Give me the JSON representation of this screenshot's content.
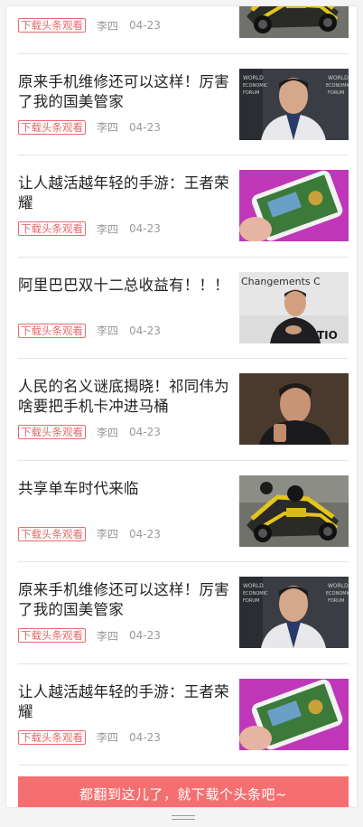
{
  "feed": {
    "items": [
      {
        "title": "",
        "tag": "下载头条观看",
        "author": "李四",
        "date": "04-23",
        "image": "robot-vehicle"
      },
      {
        "title": "原来手机维修还可以这样！厉害了我的国美管家",
        "tag": "下载头条观看",
        "author": "李四",
        "date": "04-23",
        "image": "forum-speaker"
      },
      {
        "title": "让人越活越年轻的手游：王者荣耀",
        "tag": "下载头条观看",
        "author": "李四",
        "date": "04-23",
        "image": "mobile-game"
      },
      {
        "title": "阿里巴巴双十二总收益有！！！",
        "tag": "下载头条观看",
        "author": "李四",
        "date": "04-23",
        "image": "stage-speaker",
        "image_text": "Changements C"
      },
      {
        "title": "人民的名义谜底揭晓！祁同伟为啥要把手机卡冲进马桶",
        "tag": "下载头条观看",
        "author": "李四",
        "date": "04-23",
        "image": "actor-portrait"
      },
      {
        "title": "共享单车时代来临",
        "tag": "下载头条观看",
        "author": "李四",
        "date": "04-23",
        "image": "robot-vehicle"
      },
      {
        "title": "原来手机维修还可以这样！厉害了我的国美管家",
        "tag": "下载头条观看",
        "author": "李四",
        "date": "04-23",
        "image": "forum-speaker"
      },
      {
        "title": "让人越活越年轻的手游：王者荣耀",
        "tag": "下载头条观看",
        "author": "李四",
        "date": "04-23",
        "image": "mobile-game"
      }
    ]
  },
  "cta": {
    "label": "都翻到这儿了，就下载个头条吧~"
  },
  "colors": {
    "accent": "#f56f70",
    "tag": "#e9696b",
    "meta": "#999999",
    "title": "#222222"
  }
}
